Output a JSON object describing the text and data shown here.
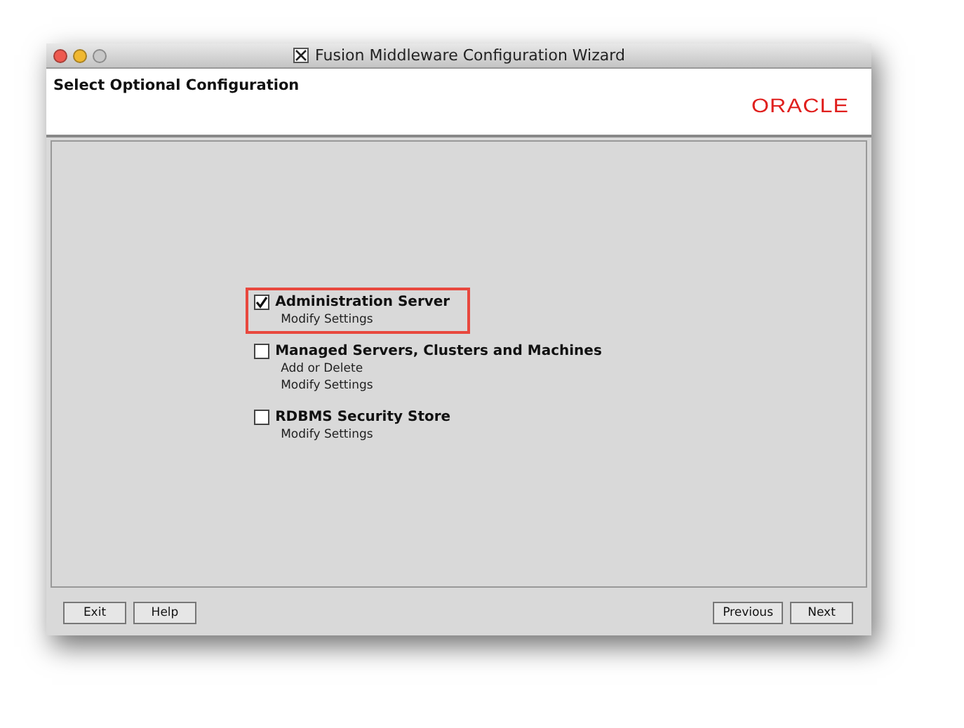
{
  "window": {
    "title": "Fusion Middleware Configuration Wizard"
  },
  "header": {
    "title": "Select Optional Configuration",
    "logo": "ORACLE"
  },
  "options": [
    {
      "label": "Administration Server",
      "checked": true,
      "highlighted": true,
      "details": [
        "Modify Settings"
      ]
    },
    {
      "label": "Managed Servers, Clusters and Machines",
      "checked": false,
      "highlighted": false,
      "details": [
        "Add or Delete",
        "Modify Settings"
      ]
    },
    {
      "label": "RDBMS Security Store",
      "checked": false,
      "highlighted": false,
      "details": [
        "Modify Settings"
      ]
    }
  ],
  "buttons_left": [
    "Exit",
    "Help"
  ],
  "buttons_right": [
    "Previous",
    "Next"
  ]
}
